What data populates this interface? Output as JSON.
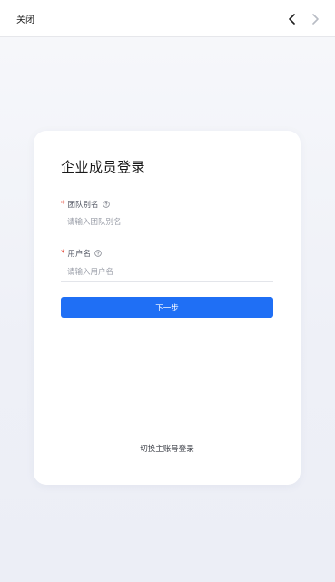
{
  "topbar": {
    "close_label": "关闭",
    "back_icon": "chevron-left-icon",
    "forward_icon": "chevron-right-icon"
  },
  "login": {
    "title": "企业成员登录",
    "team_alias": {
      "label": "团队别名",
      "required_mark": "*",
      "placeholder": "请输入团队别名",
      "value": ""
    },
    "username": {
      "label": "用户名",
      "required_mark": "*",
      "placeholder": "请输入用户名",
      "value": ""
    },
    "next_button": "下一步",
    "switch_link": "切换主账号登录"
  },
  "colors": {
    "primary": "#1f6ff5",
    "required": "#e34d3d"
  }
}
